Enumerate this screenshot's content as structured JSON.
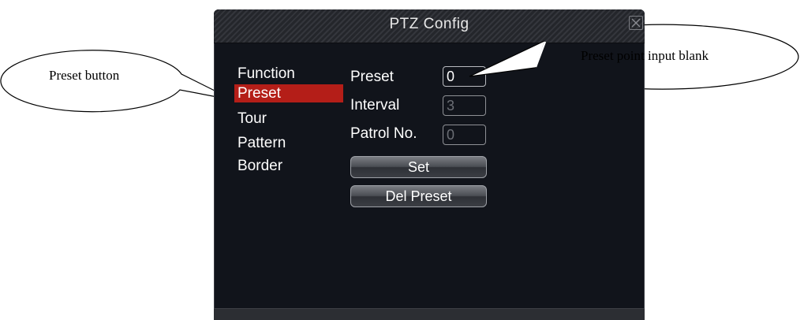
{
  "window": {
    "title": "PTZ Config",
    "close_icon": "close-icon"
  },
  "menu": {
    "items": [
      {
        "label": "Function",
        "selected": false
      },
      {
        "label": "Preset",
        "selected": true
      },
      {
        "label": "Tour",
        "selected": false
      },
      {
        "label": "Pattern",
        "selected": false
      },
      {
        "label": "Border",
        "selected": false
      }
    ]
  },
  "form": {
    "preset": {
      "label": "Preset",
      "value": "0"
    },
    "interval": {
      "label": "Interval",
      "value": "3"
    },
    "patrol": {
      "label": "Patrol No.",
      "value": "0"
    },
    "set_label": "Set",
    "del_preset_label": "Del Preset"
  },
  "callouts": {
    "preset_button": "Preset button",
    "preset_input": "Preset point input blank"
  },
  "colors": {
    "selected_item": "#b41e18",
    "window_bg": "#11141b"
  }
}
